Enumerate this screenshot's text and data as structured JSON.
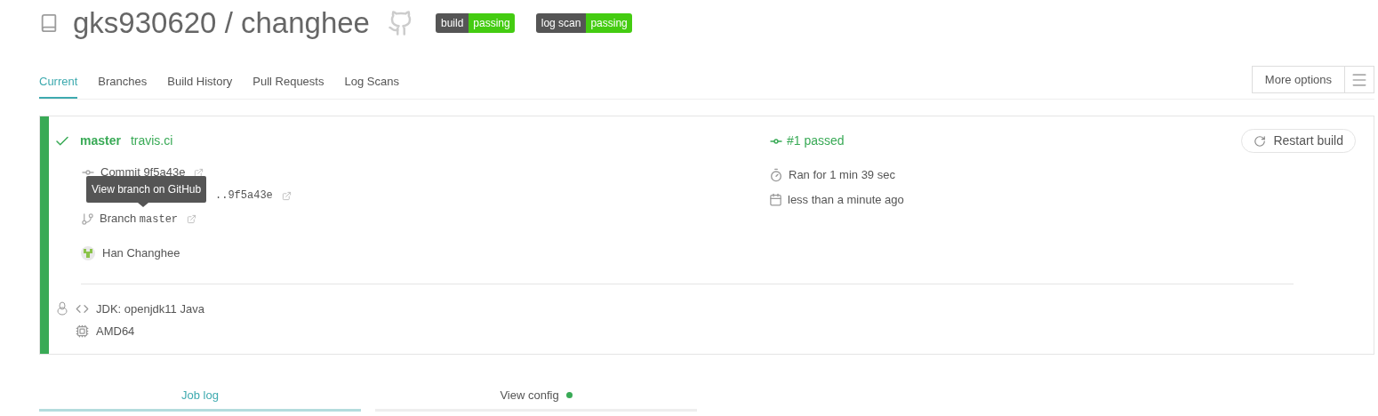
{
  "repo": {
    "owner": "gks930620",
    "name": "changhee",
    "separator": "/"
  },
  "badges": [
    {
      "label": "build",
      "status": "passing"
    },
    {
      "label": "log scan",
      "status": "passing"
    }
  ],
  "tabs": [
    {
      "label": "Current",
      "selected": true
    },
    {
      "label": "Branches",
      "selected": false
    },
    {
      "label": "Build History",
      "selected": false
    },
    {
      "label": "Pull Requests",
      "selected": false
    },
    {
      "label": "Log Scans",
      "selected": false
    }
  ],
  "more_options": "More options",
  "build": {
    "kind": "passed",
    "branch": "master",
    "message": "travis.ci",
    "number": "#1 passed",
    "commit": "Commit 9f5a43e",
    "compare": "..9f5a43e",
    "branch_label": "Branch",
    "branch_name": "master",
    "author": "Han Changhee",
    "duration": "Ran for 1 min 39 sec",
    "finished": "less than a minute ago",
    "restart": "Restart build",
    "jdk": "JDK: openjdk11 Java",
    "arch": "AMD64"
  },
  "tooltip": "View branch on GitHub",
  "bottom_tabs": [
    {
      "label": "Job log",
      "selected": true
    },
    {
      "label": "View config",
      "selected": false,
      "color": "#39aa56"
    }
  ]
}
